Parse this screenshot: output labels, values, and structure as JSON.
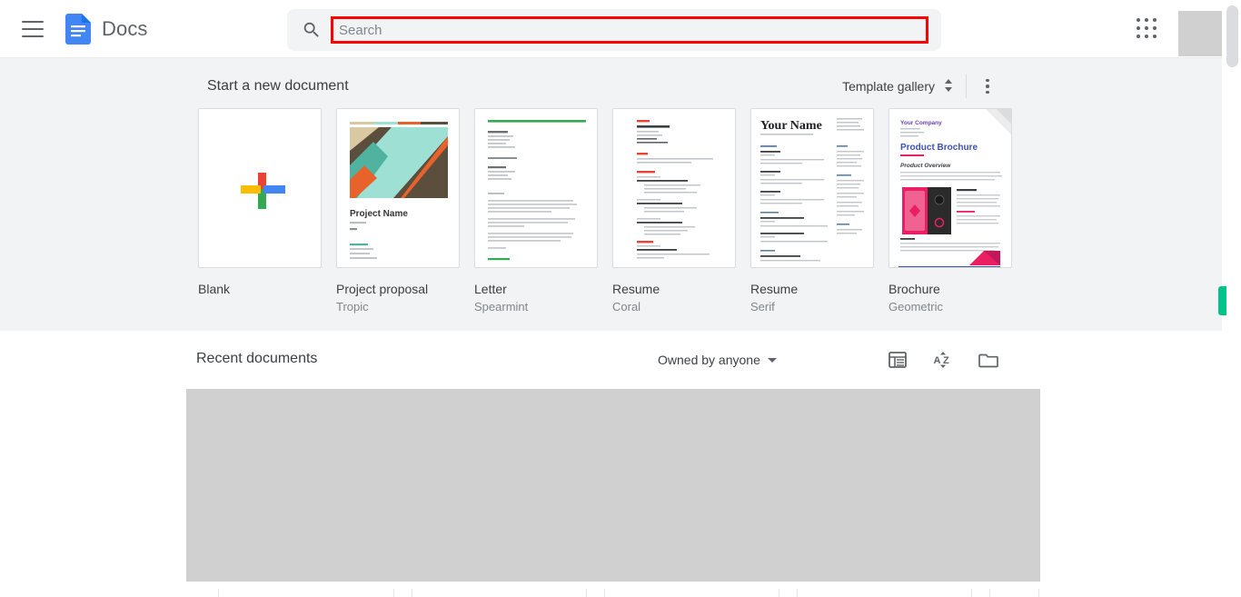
{
  "header": {
    "menu_icon": "hamburger-icon",
    "logo_icon": "docs-logo-icon",
    "brand": "Docs",
    "search": {
      "icon": "search-icon",
      "value": "",
      "placeholder": "Search"
    },
    "apps_icon": "apps-grid-icon",
    "avatar": "avatar-placeholder"
  },
  "templates": {
    "title": "Start a new document",
    "gallery_label": "Template gallery",
    "gallery_toggle_icon": "chevron-up-down-icon",
    "more_icon": "more-vert-icon",
    "items": [
      {
        "label": "Blank",
        "sub": "",
        "thumb": "blank-plus"
      },
      {
        "label": "Project proposal",
        "sub": "Tropic",
        "thumb": "tropic"
      },
      {
        "label": "Letter",
        "sub": "Spearmint",
        "thumb": "spearmint"
      },
      {
        "label": "Resume",
        "sub": "Coral",
        "thumb": "coral"
      },
      {
        "label": "Resume",
        "sub": "Serif",
        "thumb": "serif"
      },
      {
        "label": "Brochure",
        "sub": "Geometric",
        "thumb": "geometric"
      }
    ],
    "thumb_text": {
      "project_name": "Project Name",
      "your_name": "Your Name",
      "your_company": "Your Company",
      "product_brochure": "Product Brochure",
      "product_overview": "Product Overview"
    }
  },
  "recent": {
    "title": "Recent documents",
    "owner_filter": "Owned by anyone",
    "owner_caret_icon": "caret-down-icon",
    "list_view_icon": "list-view-icon",
    "sort_icon": "sort-az-icon",
    "folder_icon": "folder-icon"
  },
  "colors": {
    "background": "#f1f3f4",
    "brand_blue": "#4285f4",
    "google_red": "#ea4335",
    "google_yellow": "#fbbc04",
    "google_green": "#34a853",
    "highlight_red": "#ff0000",
    "sheets_green": "#00c389"
  }
}
